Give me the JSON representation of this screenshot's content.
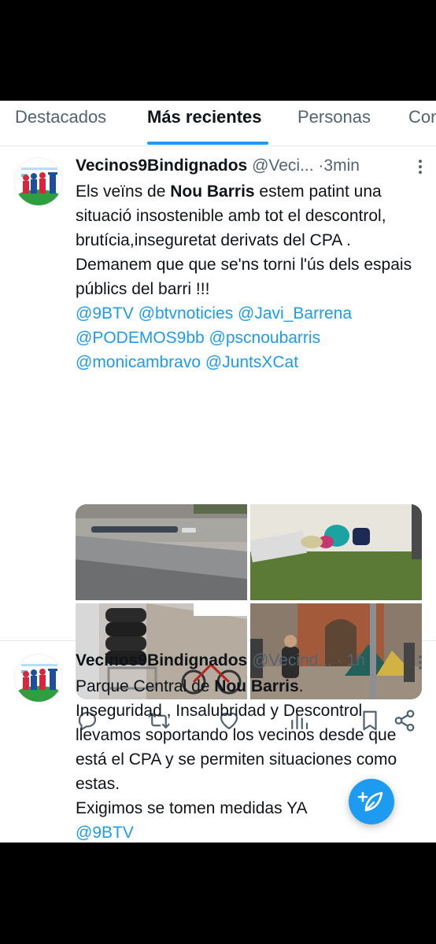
{
  "tabs": [
    "Destacados",
    "Más recientes",
    "Personas",
    "Con"
  ],
  "active_tab": "Más recientes",
  "tweets": [
    {
      "name": "Vecinos9Bindignados",
      "handle": "@Veci...",
      "time": "3min",
      "dot": "·",
      "text": [
        [
          "Els veïns de ",
          "Nou Barris",
          " estem patint una situació insostenible amb tot el descontrol, brutícia,inseguretat derivats del CPA ."
        ],
        [
          "Demanem que que se'ns torni l'ús dels espais públics del barri !!!"
        ]
      ],
      "mentions": "@9BTV @btvnoticies @Javi_Barrena @PODEMOS9bb @pscnoubarris @monicambravo @JuntsXCat",
      "image_descriptions": [
        "concrete ledge with sleeping bags",
        "mattresses on grass",
        "stacked bags and bicycles",
        "tents in park"
      ]
    },
    {
      "name": "Vecinos9Bindignados",
      "handle": "@Vecind...",
      "time": "1h",
      "dot": "·",
      "text": [
        [
          "Parque Central de ",
          "Nou Barris",
          "."
        ],
        [
          "Inseguridad , Insalubridad y Descontrol llevamos soportando los vecinos desde que está el CPA y se permiten situaciones como estas."
        ],
        [
          "Exigimos se tomen medidas YA"
        ]
      ],
      "mentions": "@9BTV"
    }
  ],
  "icons": {
    "reply": "reply-icon",
    "retweet": "retweet-icon",
    "like": "heart-icon",
    "views": "views-icon",
    "bookmark": "bookmark-icon",
    "share": "share-icon",
    "compose": "compose-icon",
    "more": "more-icon"
  },
  "colors": {
    "accent": "#1d9bf0",
    "text": "#0f1419",
    "secondary": "#536471",
    "divider": "#e7e9ea"
  }
}
